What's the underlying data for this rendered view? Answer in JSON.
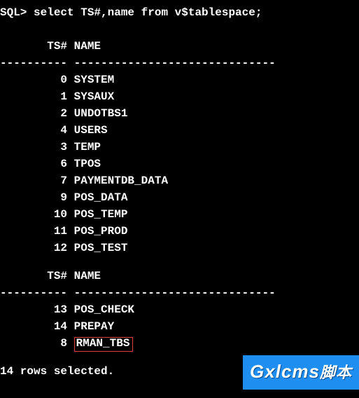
{
  "prompt": "SQL> select TS#,name from v$tablespace;",
  "header1": "       TS# NAME",
  "separator": "---------- ------------------------------",
  "rows1": [
    {
      "ts": "0",
      "name": "SYSTEM"
    },
    {
      "ts": "1",
      "name": "SYSAUX"
    },
    {
      "ts": "2",
      "name": "UNDOTBS1"
    },
    {
      "ts": "4",
      "name": "USERS"
    },
    {
      "ts": "3",
      "name": "TEMP"
    },
    {
      "ts": "6",
      "name": "TPOS"
    },
    {
      "ts": "7",
      "name": "PAYMENTDB_DATA"
    },
    {
      "ts": "9",
      "name": "POS_DATA"
    },
    {
      "ts": "10",
      "name": "POS_TEMP"
    },
    {
      "ts": "11",
      "name": "POS_PROD"
    },
    {
      "ts": "12",
      "name": "POS_TEST"
    }
  ],
  "header2": "       TS# NAME",
  "rows2": [
    {
      "ts": "13",
      "name": "POS_CHECK",
      "highlight": false
    },
    {
      "ts": "14",
      "name": "PREPAY",
      "highlight": false
    },
    {
      "ts": "8",
      "name": "RMAN_TBS",
      "highlight": true
    }
  ],
  "footer": "14 rows selected.",
  "watermark": {
    "main": "Gxlcms",
    "sub": "脚本"
  }
}
